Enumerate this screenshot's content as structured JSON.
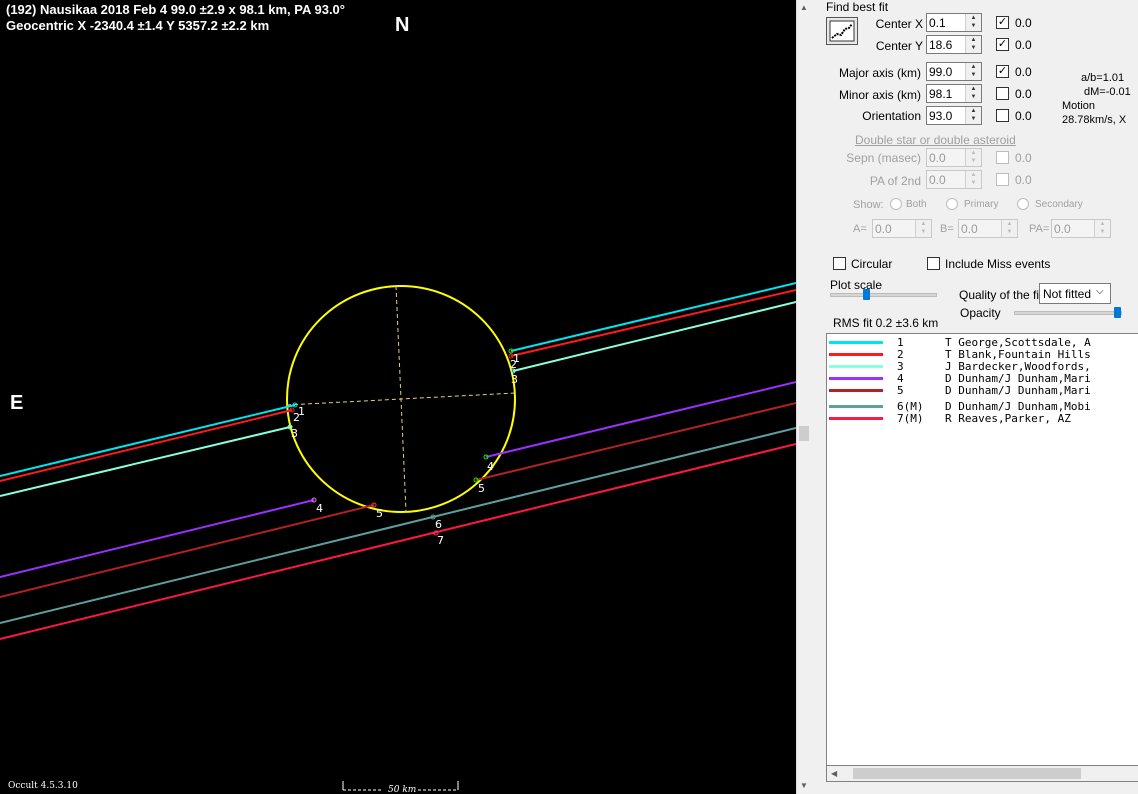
{
  "plot": {
    "header_line1": "(192) Nausikaa  2018 Feb 4   99.0 ±2.9 x 98.1 km, PA 93.0°",
    "header_line2": "Geocentric  X  -2340.4 ±1.4   Y 5357.2 ±2.2 km",
    "north_label": "N",
    "east_label": "E",
    "scale_label": "50 km",
    "version": "Occult 4.5.3.10",
    "colors": {
      "background": "#000000",
      "ellipse": "#ffff00",
      "axes": "#e0d080"
    },
    "chord_numbers": [
      "1",
      "2",
      "3",
      "4",
      "5",
      "6",
      "7"
    ]
  },
  "panel": {
    "find_best_fit": "Find best fit",
    "center_x": {
      "label": "Center X",
      "value": "0.1",
      "checked": true,
      "uncertainty": "0.0"
    },
    "center_y": {
      "label": "Center Y",
      "value": "18.6",
      "checked": true,
      "uncertainty": "0.0"
    },
    "major_axis": {
      "label": "Major axis (km)",
      "value": "99.0",
      "checked": true,
      "uncertainty": "0.0"
    },
    "minor_axis": {
      "label": "Minor axis (km)",
      "value": "98.1",
      "checked": false,
      "uncertainty": "0.0"
    },
    "orientation": {
      "label": "Orientation",
      "value": "93.0",
      "checked": false,
      "uncertainty": "0.0"
    },
    "ratio_ab": "a/b=1.01",
    "dm": "dM=-0.01",
    "motion_label": "Motion",
    "motion_value": "28.78km/s, X",
    "double_star": "Double star  or  double asteroid",
    "sepn": {
      "label": "Sepn (masec)",
      "value": "0.0",
      "uncertainty": "0.0"
    },
    "pa_2nd": {
      "label": "PA of 2nd",
      "value": "0.0",
      "uncertainty": "0.0"
    },
    "show_label": "Show:",
    "show_options": [
      "Both",
      "Primary",
      "Secondary"
    ],
    "a_label": "A=",
    "a_value": "0.0",
    "b_label": "B=",
    "b_value": "0.0",
    "pa_label": "PA=",
    "pa_value": "0.0",
    "circular_label": "Circular",
    "include_miss_label": "Include Miss events",
    "plot_scale_label": "Plot scale",
    "plot_scale_level": 0.33,
    "quality_label": "Quality of the fit",
    "quality_value": "Not fitted",
    "opacity_label": "Opacity",
    "opacity_level": 1.0,
    "rms_fit": "RMS fit 0.2 ±3.6 km"
  },
  "legend": [
    {
      "num": "1",
      "text": "T George,Scottsdale, A",
      "color": "#00e5ee"
    },
    {
      "num": "2",
      "text": "T Blank,Fountain Hills",
      "color": "#ff1a1a"
    },
    {
      "num": "3",
      "text": "J Bardecker,Woodfords,",
      "color": "#88ffdd"
    },
    {
      "num": "4",
      "text": "D Dunham/J Dunham,Mari",
      "color": "#9b30ff"
    },
    {
      "num": "5",
      "text": "D Dunham/J Dunham,Mari",
      "color": "#b22222"
    },
    {
      "num": "6(M)",
      "text": "D Dunham/J Dunham,Mobi",
      "color": "#5f9ea0"
    },
    {
      "num": "7(M)",
      "text": "R Reaves,Parker, AZ",
      "color": "#ff1744"
    }
  ]
}
